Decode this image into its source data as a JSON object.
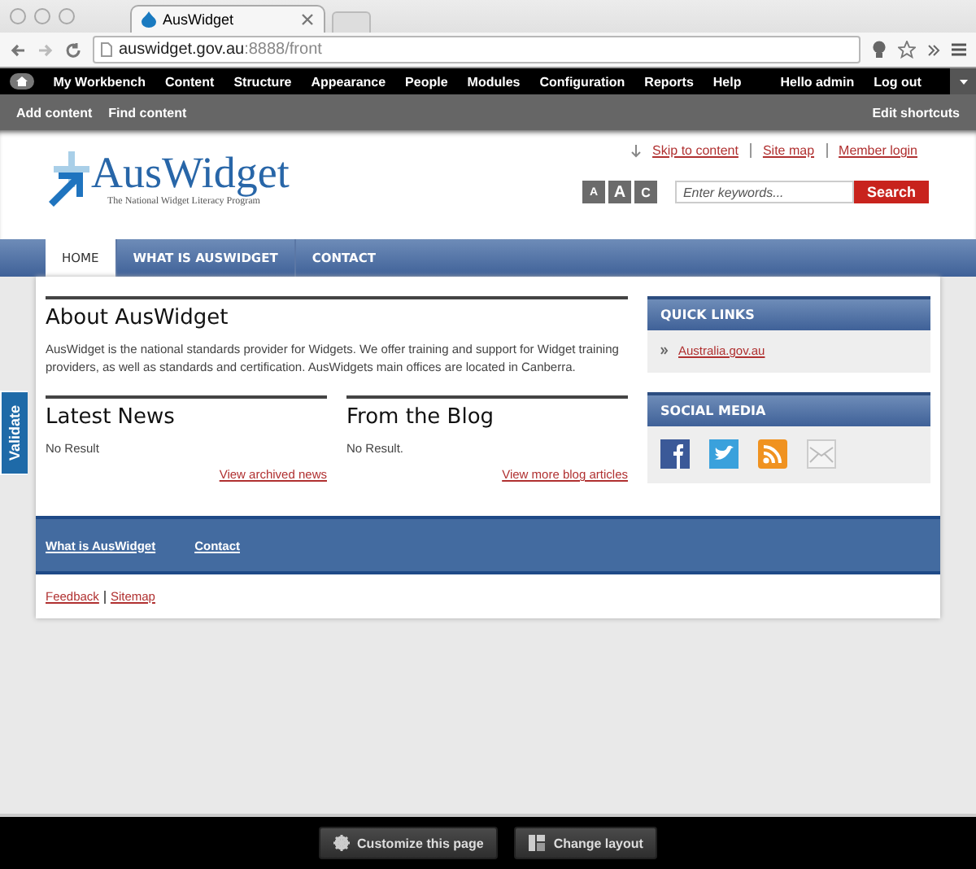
{
  "browser": {
    "tab_title": "AusWidget",
    "url_host": "auswidget.gov.au",
    "url_rest": ":8888/front"
  },
  "admin_menu": {
    "items": [
      "My Workbench",
      "Content",
      "Structure",
      "Appearance",
      "People",
      "Modules",
      "Configuration",
      "Reports",
      "Help"
    ],
    "user": "Hello admin",
    "logout": "Log out"
  },
  "shortcuts": {
    "items": [
      "Add content",
      "Find content"
    ],
    "edit": "Edit shortcuts"
  },
  "header": {
    "logo": "AusWidget",
    "tagline": "The National Widget Literacy Program",
    "links": [
      "Skip to content",
      "Site map",
      "Member login"
    ],
    "text_size_buttons": [
      "A",
      "A",
      "C"
    ],
    "search": {
      "placeholder": "Enter keywords...",
      "button": "Search"
    }
  },
  "nav": [
    {
      "label": "HOME",
      "selected": true
    },
    {
      "label": "WHAT IS AUSWIDGET",
      "selected": false
    },
    {
      "label": "CONTACT",
      "selected": false
    }
  ],
  "about": {
    "title": "About AusWidget",
    "body": "AusWidget is the national standards provider for Widgets. We offer training and support for Widget training providers, as well as standards and certification. AusWidgets main offices are located in Canberra."
  },
  "blocks": [
    {
      "title": "Latest News",
      "body": "No Result",
      "link": "View archived news"
    },
    {
      "title": "From the Blog",
      "body": "No Result.",
      "link": "View more blog articles"
    }
  ],
  "sidebar": [
    {
      "title": "QUICK LINKS",
      "kind": "links",
      "links": [
        "Australia.gov.au"
      ]
    },
    {
      "title": "SOCIAL MEDIA",
      "kind": "social"
    }
  ],
  "footer": {
    "links": [
      "What is AusWidget",
      "Contact"
    ],
    "bottom_links": [
      "Feedback",
      "Sitemap"
    ]
  },
  "validate_tab": "Validate",
  "bottom_bar": {
    "buttons": [
      "Customize this page",
      "Change layout"
    ]
  }
}
